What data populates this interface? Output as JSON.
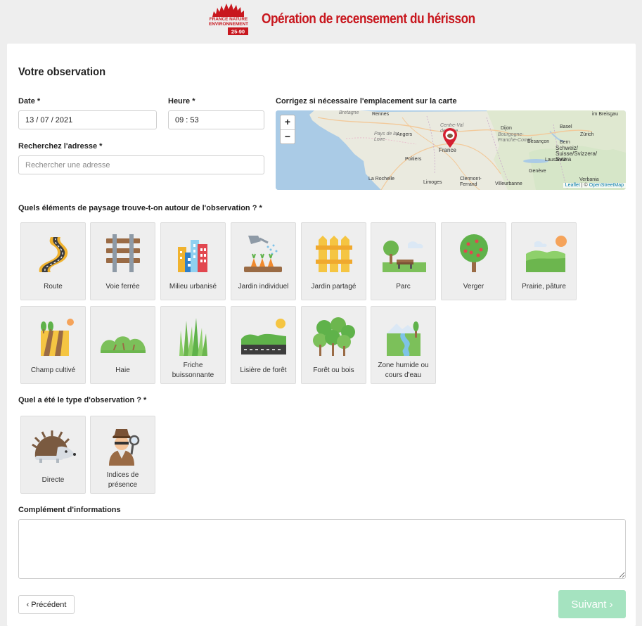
{
  "header": {
    "logo_lines": [
      "FRANCE NATURE",
      "ENVIRONNEMENT",
      "25-90"
    ],
    "title": "Opération de recensement du hérisson"
  },
  "form": {
    "section_title": "Votre observation",
    "date_label": "Date *",
    "date_value": "13 / 07 / 2021",
    "time_label": "Heure *",
    "time_value": "09 : 53",
    "address_label": "Recherchez l'adresse *",
    "address_placeholder": "Rechercher une adresse",
    "map_label": "Corrigez si nécessaire l'emplacement sur la carte",
    "landscape_label": "Quels éléments de paysage trouve-t-on autour de l'observation ? *",
    "observation_label": "Quel a été le type d'observation ? *",
    "complement_label": "Complément d'informations",
    "prev_button": "‹ Précédent",
    "next_button": "Suivant ›"
  },
  "map": {
    "zoom_in": "+",
    "zoom_out": "−",
    "attribution_leaflet": "Leaflet",
    "attribution_sep": " | © ",
    "attribution_osm": "OpenStreetMap",
    "places": {
      "bretagne": "Bretagne",
      "rennes": "Rennes",
      "angers": "Angers",
      "pays_loire": "Pays de la Loire",
      "centre": "Centre-Val de Loire",
      "france": "France",
      "bourgogne": "Bourgogne-Franche-Comté",
      "poitiers": "Poitiers",
      "la_rochelle": "La Rochelle",
      "limoges": "Limoges",
      "clermont": "Clermont-Ferrand",
      "villeurbanne": "Villeurbanne",
      "geneve": "Genève",
      "lausanne": "Lausanne",
      "schweiz": "Schweiz/ Suisse/Svizzera/ Svizra",
      "zurich": "Zürich",
      "basel": "Basel",
      "breisgau": "im Breisgau",
      "bern": "Bern",
      "besancon": "Besançon",
      "dijon": "Dijon",
      "verbania": "Verbania"
    }
  },
  "landscape_options": [
    {
      "label": "Route",
      "icon": "road-icon"
    },
    {
      "label": "Voie ferrée",
      "icon": "railway-icon"
    },
    {
      "label": "Milieu urbanisé",
      "icon": "city-icon"
    },
    {
      "label": "Jardin individuel",
      "icon": "garden-watering-icon"
    },
    {
      "label": "Jardin partagé",
      "icon": "fence-icon"
    },
    {
      "label": "Parc",
      "icon": "park-bench-icon"
    },
    {
      "label": "Verger",
      "icon": "orchard-tree-icon"
    },
    {
      "label": "Prairie, pâture",
      "icon": "meadow-icon"
    },
    {
      "label": "Champ cultivé",
      "icon": "field-icon"
    },
    {
      "label": "Haie",
      "icon": "hedge-icon"
    },
    {
      "label": "Friche buissonnante",
      "icon": "tall-grass-icon"
    },
    {
      "label": "Lisière de forêt",
      "icon": "forest-edge-icon"
    },
    {
      "label": "Forêt ou bois",
      "icon": "forest-icon"
    },
    {
      "label": "Zone humide ou cours d'eau",
      "icon": "wetland-icon"
    }
  ],
  "observation_types": [
    {
      "label": "Directe",
      "icon": "hedgehog-icon"
    },
    {
      "label": "Indices de présence",
      "icon": "detective-icon"
    }
  ],
  "colors": {
    "brand_red": "#c8171e",
    "next_button_disabled": "#a5e3c0",
    "tile_bg": "#eeeeee"
  }
}
